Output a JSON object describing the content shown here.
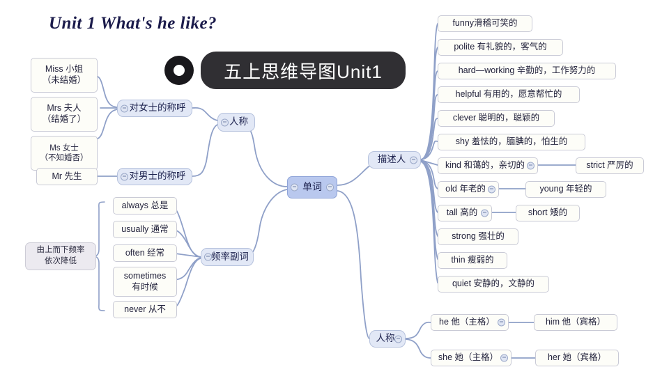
{
  "heading": "Unit 1 What's he like?",
  "title_badge": {
    "label": "五上思维导图Unit1",
    "icon": "ring-icon"
  },
  "root": {
    "label": "单词"
  },
  "branches": {
    "person_titles": {
      "label": "人称",
      "children": [
        {
          "label": "对女士的称呼",
          "items": [
            {
              "en": "Miss 小姐",
              "zh": "（未结婚）"
            },
            {
              "en": "Mrs 夫人",
              "zh": "（结婚了）"
            },
            {
              "en": "Ms 女士",
              "zh": "（不知婚否）"
            }
          ]
        },
        {
          "label": "对男士的称呼",
          "items": [
            {
              "en": "Mr 先生",
              "zh": ""
            }
          ]
        }
      ]
    },
    "frequency": {
      "label": "频率副词",
      "note": "由上而下频率\n依次降低",
      "note_line1": "由上而下频率",
      "note_line2": "依次降低",
      "items": [
        {
          "en": "always 总是",
          "zh": ""
        },
        {
          "en": "usually 通常",
          "zh": ""
        },
        {
          "en": "often 经常",
          "zh": ""
        },
        {
          "en": "sometimes",
          "zh": "有时候"
        },
        {
          "en": "never 从不",
          "zh": ""
        }
      ]
    },
    "describe_people": {
      "label": "描述人",
      "items": [
        {
          "label": "funny滑稽可笑的",
          "opposite": null
        },
        {
          "label": "polite 有礼貌的，客气的",
          "opposite": null
        },
        {
          "label": "hard—working 辛勤的，工作努力的",
          "opposite": null
        },
        {
          "label": "helpful 有用的，愿意帮忙的",
          "opposite": null
        },
        {
          "label": "clever 聪明的，聪颖的",
          "opposite": null
        },
        {
          "label": "shy 羞怯的，腼腆的，怕生的",
          "opposite": null
        },
        {
          "label": "kind 和蔼的，亲切的",
          "opposite": "strict 严厉的"
        },
        {
          "label": "old 年老的",
          "opposite": "young 年轻的"
        },
        {
          "label": "tall 高的",
          "opposite": "short 矮的"
        },
        {
          "label": "strong 强壮的",
          "opposite": null
        },
        {
          "label": "thin 瘦弱的",
          "opposite": null
        },
        {
          "label": "quiet 安静的，文静的",
          "opposite": null
        }
      ]
    },
    "pronouns": {
      "label": "人称",
      "items": [
        {
          "subject": "he 他（主格）",
          "object": "him 他（宾格）"
        },
        {
          "subject": "she 她（主格）",
          "object": "her 她（宾格）"
        }
      ]
    }
  },
  "colors": {
    "root_fill": "#b9c8ee",
    "level1_fill": "#e2e8f6",
    "leaf_fill": "#fdfdf8",
    "note_fill": "#eceaf0",
    "link": "#8fa0c8",
    "badge_bg": "#302f33",
    "heading_text": "#1b1b4b"
  }
}
